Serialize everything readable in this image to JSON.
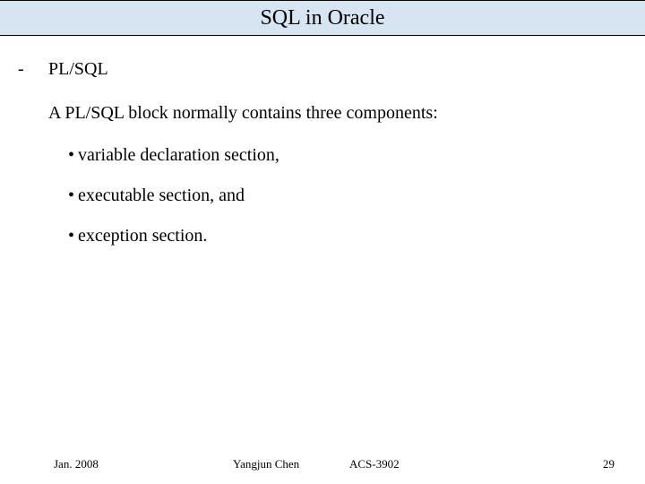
{
  "title": "SQL in Oracle",
  "dash": "-",
  "subtitle": "PL/SQL",
  "intro": "A PL/SQL block normally contains three components:",
  "bullet_char": "•",
  "bullets": [
    "variable declaration section,",
    "executable section, and",
    "exception section."
  ],
  "footer": {
    "date": "Jan. 2008",
    "author": "Yangjun Chen",
    "course": "ACS-3902",
    "page": "29"
  }
}
